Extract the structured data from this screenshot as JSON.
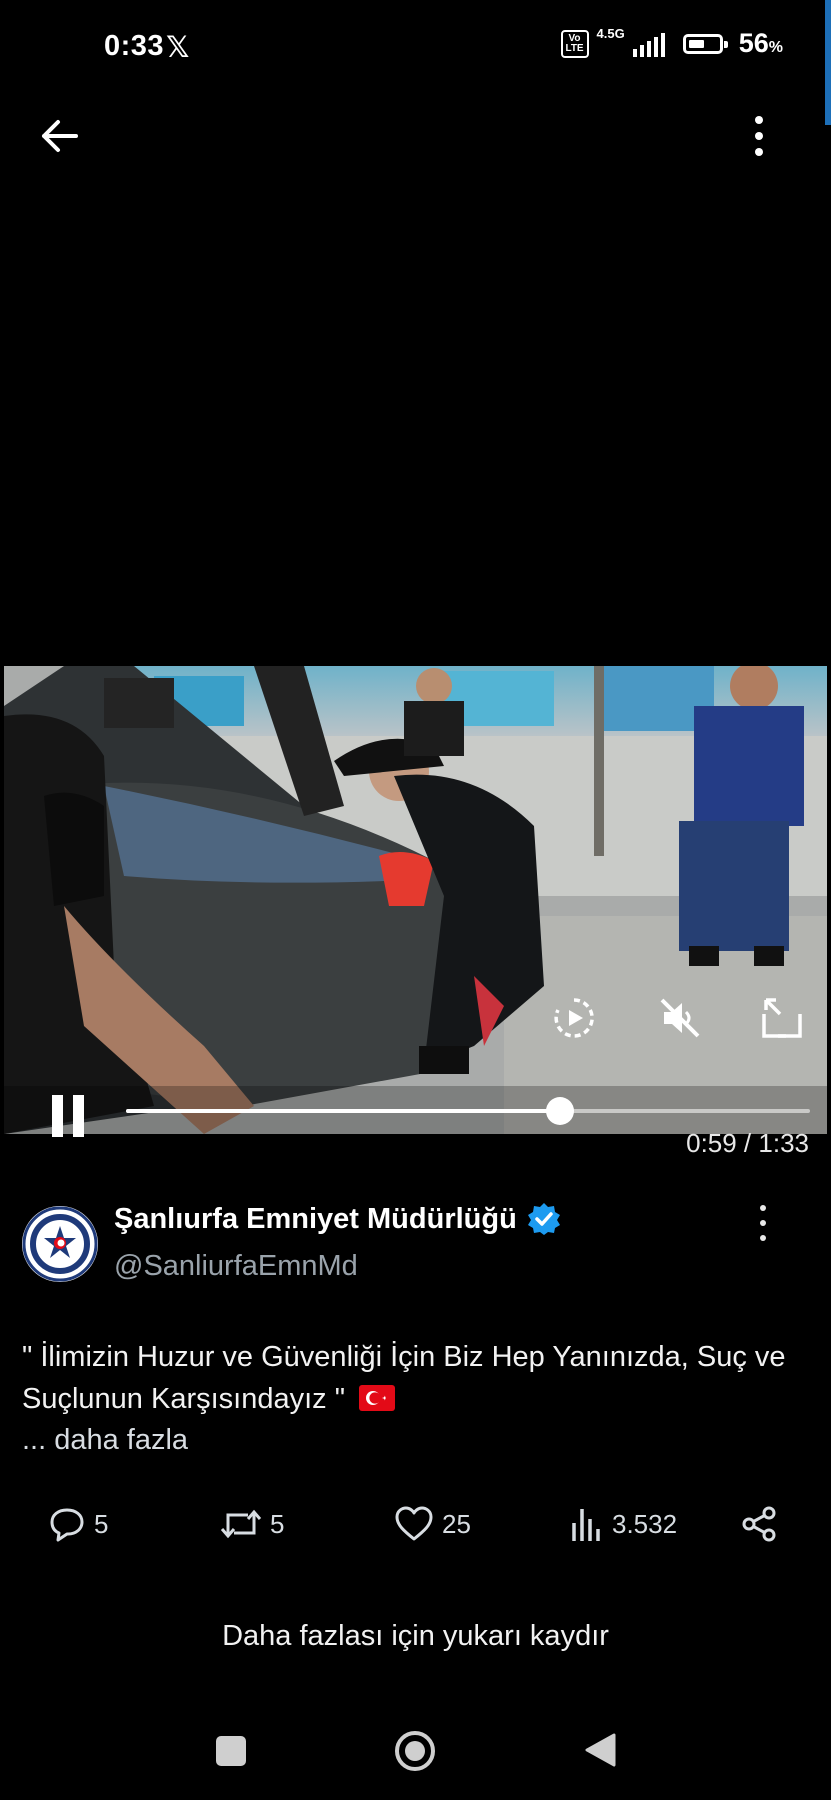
{
  "status_bar": {
    "time": "0:33",
    "app_indicator": "𝕏",
    "volte": "Vo LTE",
    "network_type": "4.5G",
    "battery_percent": "56",
    "battery_unit": "%",
    "battery_level": 0.56,
    "icons": [
      "x-logo-icon",
      "volte-icon",
      "signal-icon",
      "battery-icon"
    ]
  },
  "top_bar": {
    "back_icon": "arrow-left-icon",
    "more_icon": "more-vertical-icon"
  },
  "video": {
    "current_time": "0:59",
    "separator": " / ",
    "duration": "1:33",
    "time_readout": "0:59 / 1:33",
    "progress": 0.634,
    "controls": [
      "replay-icon",
      "mute-icon",
      "fullscreen-icon",
      "pause-icon"
    ]
  },
  "tweet": {
    "author_name": "Şanlıurfa Emniyet Müdürlüğü",
    "author_handle": "@SanliurfaEmnMd",
    "verified": true,
    "text": "\" İlimizin Huzur ve Güvenliği İçin Biz Hep Yanınızda, Suç ve Suçlunun Karşısındayız \"",
    "flag": "turkey-flag-emoji",
    "show_more": "... daha fazla"
  },
  "actions": {
    "replies": "5",
    "reposts": "5",
    "likes": "25",
    "views": "3.532"
  },
  "hint": {
    "text": "Daha fazlası için yukarı kaydır"
  },
  "nav": [
    "recents-icon",
    "home-icon",
    "back-icon"
  ],
  "colors": {
    "background": "#000000",
    "verified": "#1d9bf0",
    "secondary_text": "#9aa3ab",
    "flag_red": "#e30a17"
  }
}
